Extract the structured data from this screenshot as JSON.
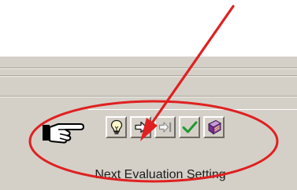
{
  "colors": {
    "panel_gray": "#d4d0c8",
    "annotation_red": "#e02020",
    "checkmark_green": "#1f9a2a"
  },
  "toolbar": {
    "buttons": [
      {
        "icon": "lightbulb-icon"
      },
      {
        "icon": "next-arrow-icon"
      },
      {
        "icon": "skip-to-end-icon"
      },
      {
        "icon": "checkmark-icon"
      },
      {
        "icon": "book-icon"
      }
    ]
  },
  "caption": {
    "label": "Next Evaluation Setting"
  },
  "annotation": {
    "shapes": [
      "red-arrow",
      "red-ellipse"
    ]
  }
}
